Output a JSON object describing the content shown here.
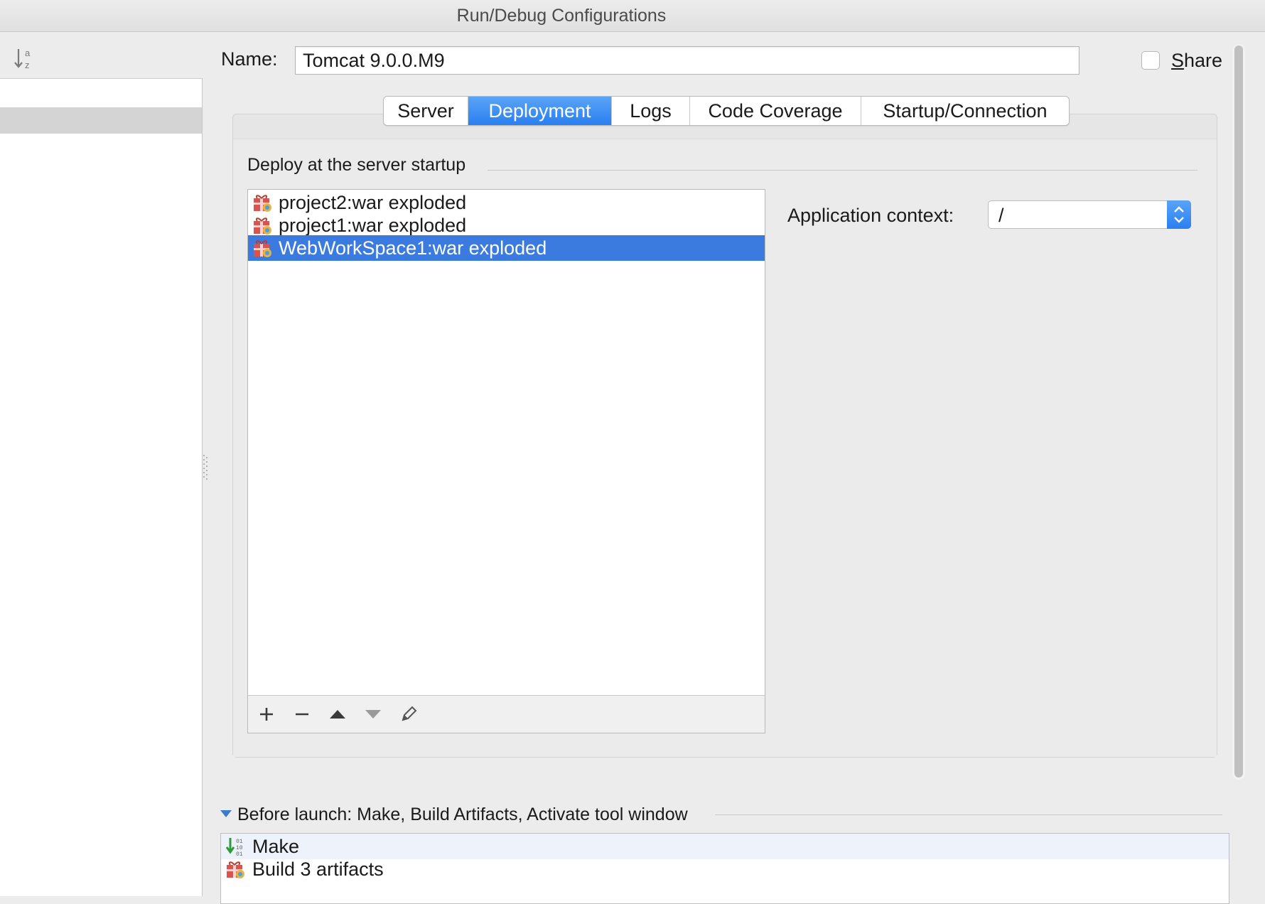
{
  "window": {
    "title": "Run/Debug Configurations"
  },
  "left_pane": {
    "toolbar_icon": "sort-alpha-icon"
  },
  "name_row": {
    "label": "Name:",
    "value": "Tomcat 9.0.0.M9"
  },
  "share": {
    "label_mnemonic": "S",
    "label_rest": "hare",
    "checked": false
  },
  "tabs": [
    {
      "label": "Server",
      "active": false
    },
    {
      "label": "Deployment",
      "active": true
    },
    {
      "label": "Logs",
      "active": false
    },
    {
      "label": "Code Coverage",
      "active": false
    },
    {
      "label": "Startup/Connection",
      "active": false
    }
  ],
  "deploy": {
    "section_title": "Deploy at the server startup",
    "items": [
      {
        "label": "project2:war exploded",
        "icon": "artifact-icon",
        "selected": false
      },
      {
        "label": "project1:war exploded",
        "icon": "artifact-icon",
        "selected": false
      },
      {
        "label": "WebWorkSpace1:war exploded",
        "icon": "artifact-icon",
        "selected": true
      }
    ],
    "toolbar": [
      "add-icon",
      "remove-icon",
      "move-up-icon",
      "move-down-icon",
      "edit-icon"
    ]
  },
  "app_context": {
    "label": "Application context:",
    "value": "/"
  },
  "before_launch": {
    "title": "Before launch: Make, Build Artifacts, Activate tool window",
    "items": [
      {
        "label": "Make",
        "icon": "make-icon"
      },
      {
        "label": "Build 3 artifacts",
        "icon": "artifact-icon"
      }
    ]
  },
  "colors": {
    "selection": "#3b7be0",
    "accent": "#2a7ff0"
  }
}
